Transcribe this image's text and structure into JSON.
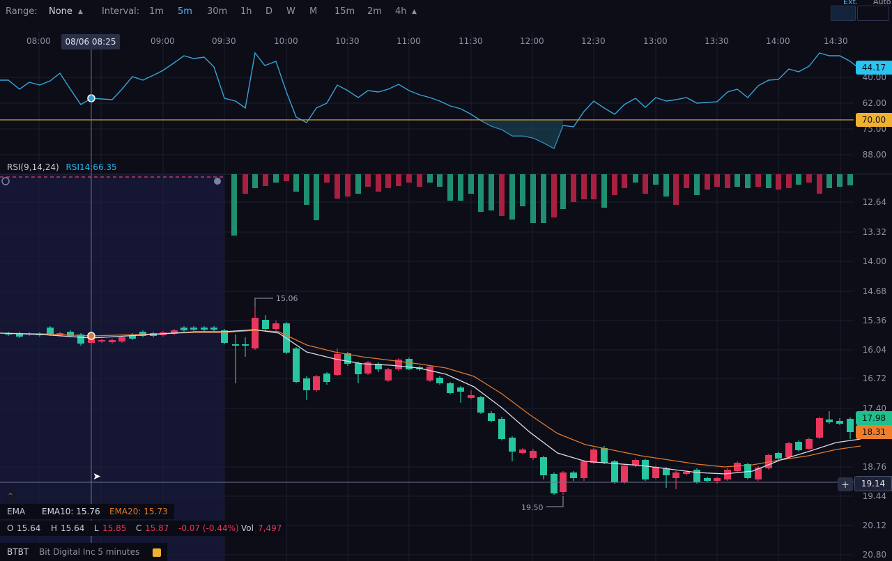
{
  "symbol": {
    "ticker": "BTBT",
    "name": "Bit Digital Inc 5 minutes"
  },
  "ohlc": {
    "o_label": "O",
    "o": "15.64",
    "h_label": "H",
    "h": "15.64",
    "l_label": "L",
    "l": "15.85",
    "c_label": "C",
    "c": "15.87",
    "change": "-0.07 (-0.44%)",
    "vol_label": "Vol",
    "vol": "7,497"
  },
  "ema": {
    "label": "EMA",
    "ema10": "EMA10: 15.76",
    "ema20": "EMA20: 15.73"
  },
  "rsi": {
    "label": "RSI(9,14,24)",
    "value": "RSI14:66.35"
  },
  "toolbar": {
    "range_label": "Range:",
    "range_value": "None",
    "interval_label": "Interval:",
    "intervals": [
      "1m",
      "5m",
      "30m",
      "1h",
      "D",
      "W",
      "M",
      "15m",
      "2m",
      "4h"
    ],
    "active_interval": "5m",
    "ext": "Ext.",
    "auto": "Auto"
  },
  "time_axis": {
    "labels": [
      "08:00",
      "09:00",
      "09:30",
      "10:00",
      "10:30",
      "11:00",
      "11:30",
      "12:00",
      "12:30",
      "13:00",
      "13:30",
      "14:00",
      "14:30"
    ],
    "crosshair_time": "08/06 08:25"
  },
  "price_axis": {
    "labels": [
      "12.64",
      "13.32",
      "14.00",
      "14.68",
      "15.36",
      "16.04",
      "16.72",
      "17.40",
      "18.76",
      "19.44",
      "20.12",
      "20.80"
    ],
    "last_price": "17.98",
    "ema_value": "18.31",
    "crosshair_price": "19.14"
  },
  "rsi_axis": {
    "labels": [
      "40.00",
      "62.00",
      "75.00",
      "88.00"
    ],
    "rsi_current": "44.17",
    "threshold": "70.00"
  },
  "annotations": {
    "high_marker": "15.06",
    "low_marker": "19.50"
  },
  "colors": {
    "up": "#26c6a0",
    "down": "#e8365d",
    "ema10": "#d9dce8",
    "ema20": "#e07a2e",
    "rsi": "#3aa3d6",
    "threshold": "#d9a23a",
    "accent": "#29b6f6",
    "session_bg": "#17193d"
  }
}
